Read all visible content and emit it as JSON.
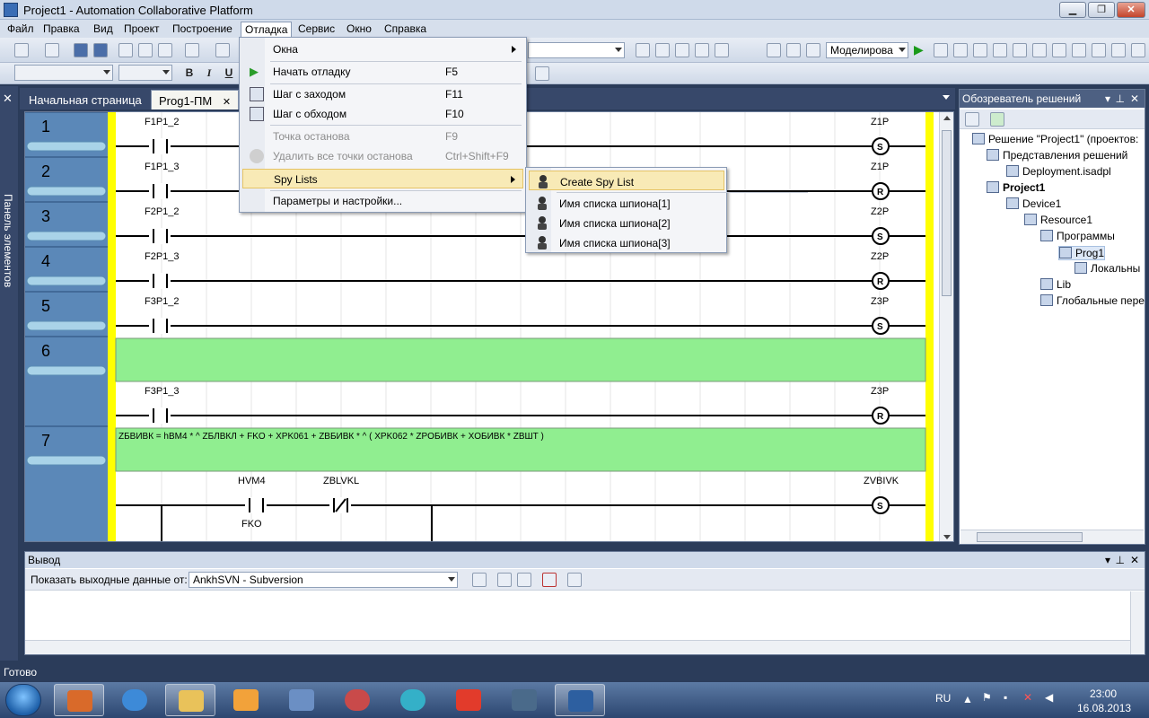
{
  "window": {
    "title": "Project1 - Automation Collaborative Platform",
    "minimize": "▁",
    "maximize": "❐",
    "close": "✕"
  },
  "menubar": {
    "items": [
      "Файл",
      "Правка",
      "Вид",
      "Проект",
      "Построение",
      "Отладка",
      "Сервис",
      "Окно",
      "Справка"
    ]
  },
  "toolbar": {
    "mode_combo": "Моделирова",
    "format_bold": "B",
    "format_italic": "I",
    "format_underline": "U"
  },
  "left_strip": {
    "label": "Панель элементов"
  },
  "doc_tabs": [
    {
      "label": "Начальная страница",
      "active": false
    },
    {
      "label": "Prog1-ПМ",
      "active": true,
      "close": "✕"
    }
  ],
  "ladder": {
    "rungs": [
      {
        "num": "1",
        "contact": "F1P1_2",
        "coil": "Z1P",
        "coil_type": "S"
      },
      {
        "num": "2",
        "contact": "F1P1_3",
        "coil": "Z1P",
        "coil_type": "R"
      },
      {
        "num": "3",
        "contact": "F2P1_2",
        "coil": "Z2P",
        "coil_type": "S"
      },
      {
        "num": "4",
        "contact": "F2P1_3",
        "coil": "Z2P",
        "coil_type": "R"
      },
      {
        "num": "5",
        "contact": "F3P1_2",
        "coil": "Z3P",
        "coil_type": "S"
      },
      {
        "num": "6",
        "contact": "F3P1_3",
        "coil": "Z3P",
        "coil_type": "R"
      },
      {
        "num": "7",
        "comment": "ZБВИВК = hВМ4 * ^ ZБЛВКЛ + FKO + XPK061 + ZBБИВК * ^ ( XPK062 * ZPOБИВК + XOБИВК * ZBШТ )",
        "contact": "HVM4",
        "contact_b": "ZBLVKL",
        "branch": "FKO",
        "coil": "ZVBIVK",
        "coil_type": "S"
      }
    ]
  },
  "debug_menu": {
    "items": [
      {
        "label": "Окна",
        "shortcut": "",
        "submenu": true,
        "disabled": false
      },
      {
        "label": "Начать отладку",
        "shortcut": "F5",
        "icon": "play-icon",
        "disabled": false
      },
      {
        "label": "Шаг с заходом",
        "shortcut": "F11",
        "icon": "step-into-icon",
        "disabled": false
      },
      {
        "label": "Шаг с обходом",
        "shortcut": "F10",
        "icon": "step-over-icon",
        "disabled": false
      },
      {
        "label": "Точка останова",
        "shortcut": "F9",
        "disabled": true
      },
      {
        "label": "Удалить все точки останова",
        "shortcut": "Ctrl+Shift+F9",
        "icon": "clear-breakpoints-icon",
        "disabled": true
      },
      {
        "label": "Spy Lists",
        "shortcut": "",
        "submenu": true,
        "hover": true
      },
      {
        "label": "Параметры и настройки...",
        "shortcut": ""
      }
    ]
  },
  "spy_menu": {
    "items": [
      "Create Spy List",
      "Имя списка шпиона[1]",
      "Имя списка шпиона[2]",
      "Имя списка шпиона[3]"
    ]
  },
  "solution_explorer": {
    "title": "Обозреватель решений",
    "nodes": [
      {
        "label": "Решение \"Project1\" (проектов:",
        "level": 0
      },
      {
        "label": "Представления решений",
        "level": 1
      },
      {
        "label": "Deployment.isadpl",
        "level": 2
      },
      {
        "label": "Project1",
        "level": 1,
        "bold": true
      },
      {
        "label": "Device1",
        "level": 2
      },
      {
        "label": "Resource1",
        "level": 3
      },
      {
        "label": "Программы",
        "level": 4
      },
      {
        "label": "Prog1",
        "level": 5,
        "selected": true
      },
      {
        "label": "Локальны",
        "level": 6
      },
      {
        "label": "Lib",
        "level": 4
      },
      {
        "label": "Глобальные пере",
        "level": 4
      }
    ]
  },
  "output": {
    "title": "Вывод",
    "show_label": "Показать выходные данные от:",
    "source": "AnkhSVN - Subversion"
  },
  "status": {
    "text": "Готово"
  },
  "taskbar": {
    "lang": "RU",
    "time": "23:00",
    "date": "16.08.2013"
  },
  "colors": {
    "rung_number_bg": "#5b88b8",
    "power_rail": "#ffff00",
    "comment_bg": "#90ee90",
    "menu_hover": "#f8eab6"
  }
}
